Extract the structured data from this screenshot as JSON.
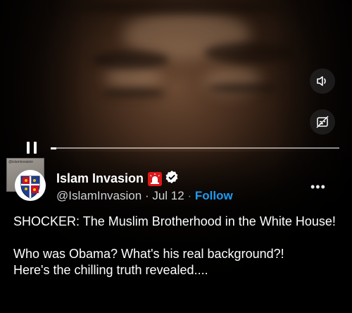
{
  "author": {
    "display_name": "Islam Invasion",
    "handle": "@IslamInvasion",
    "separator": "·",
    "date": "Jul 12",
    "follow_label": "Follow",
    "verified": true
  },
  "tweet": {
    "text": "SHOCKER: The Muslim Brotherhood in the White House!\n\nWho was Obama? What's his real background?!\nHere's the chilling truth revealed...."
  },
  "video": {
    "progress": 0.02,
    "state": "playing",
    "controls": [
      "pause-icon",
      "volume-icon",
      "captions-off-icon"
    ],
    "watermark_text": "@islaminvasion"
  },
  "colors": {
    "accent": "#1d9bf0",
    "background": "#000000",
    "text": "#ffffff",
    "siren": "#e11d1d"
  }
}
